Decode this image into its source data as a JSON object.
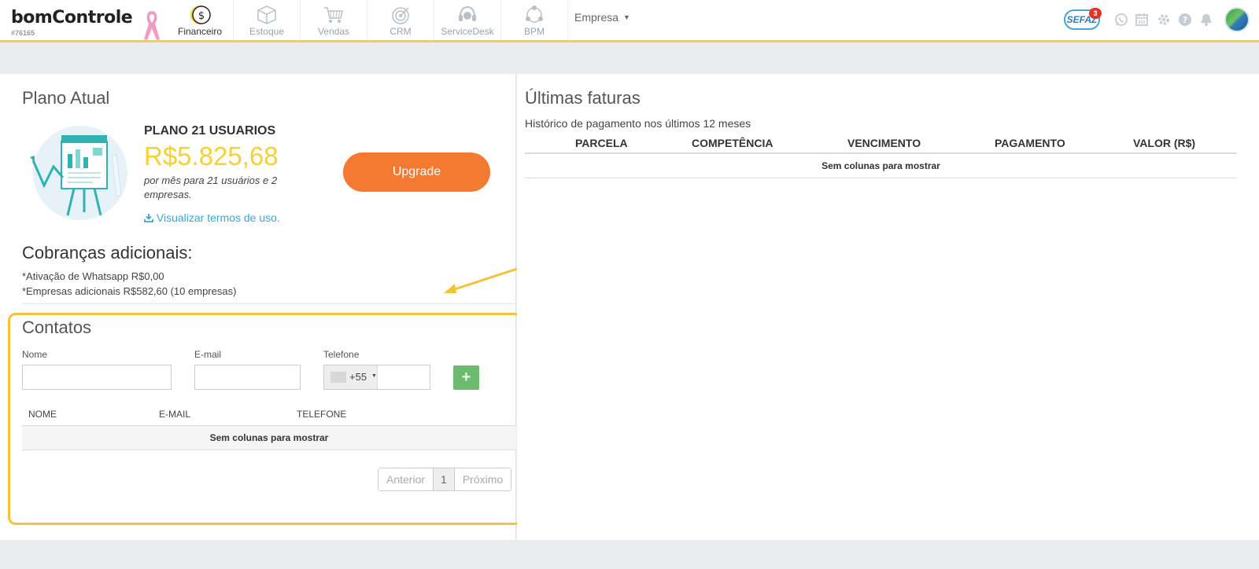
{
  "header": {
    "logo": "bomControle",
    "account_id": "#76165",
    "modules": [
      {
        "label": "Financeiro",
        "icon": "dollar-coin-icon",
        "active": true
      },
      {
        "label": "Estoque",
        "icon": "box-icon",
        "active": false
      },
      {
        "label": "Vendas",
        "icon": "cart-icon",
        "active": false
      },
      {
        "label": "CRM",
        "icon": "target-icon",
        "active": false
      },
      {
        "label": "ServiceDesk",
        "icon": "headset-icon",
        "active": false
      },
      {
        "label": "BPM",
        "icon": "process-icon",
        "active": false
      }
    ],
    "empresa_label": "Empresa",
    "sefaz_label": "SEFAZ",
    "sefaz_count": "3"
  },
  "plano": {
    "title": "Plano Atual",
    "name": "PLANO 21 USUARIOS",
    "price": "R$5.825,68",
    "description": "por mês para 21 usuários e 2 empresas.",
    "terms_link": "Visualizar termos de uso.",
    "upgrade_label": "Upgrade"
  },
  "cobrancas": {
    "title": "Cobranças adicionais:",
    "lines": [
      "*Ativação de Whatsapp R$0,00",
      "*Empresas adicionais R$582,60 (10 empresas)"
    ]
  },
  "contatos": {
    "title": "Contatos",
    "labels": {
      "nome": "Nome",
      "email": "E-mail",
      "telefone": "Telefone"
    },
    "values": {
      "nome": "",
      "email": "",
      "telefone": ""
    },
    "ddi": "+55",
    "add_label": "+",
    "columns": [
      "NOME",
      "E-MAIL",
      "TELEFONE"
    ],
    "empty_text": "Sem colunas para mostrar",
    "pagination": {
      "prev": "Anterior",
      "current": "1",
      "next": "Próximo"
    }
  },
  "faturas": {
    "title": "Últimas faturas",
    "subtitle": "Histórico de pagamento nos últimos 12 meses",
    "columns": [
      "PARCELA",
      "COMPETÊNCIA",
      "VENCIMENTO",
      "PAGAMENTO",
      "VALOR (R$)"
    ],
    "empty_text": "Sem colunas para mostrar"
  },
  "colors": {
    "accent_yellow": "#f3d23a",
    "upgrade_orange": "#f47a32",
    "price_yellow": "#f7d131",
    "link_blue": "#3aa6d8",
    "add_green": "#6dbb6f"
  }
}
